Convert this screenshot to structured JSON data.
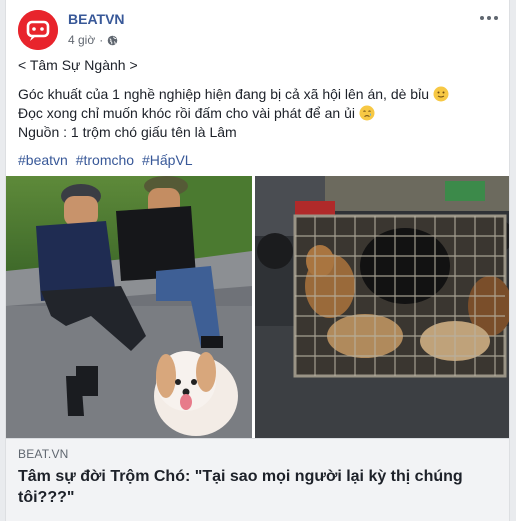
{
  "post": {
    "page_name": "BEATVN",
    "time": "4 giờ",
    "privacy_icon": "globe-icon",
    "lines": [
      "< Tâm Sự Ngành >",
      "Góc khuất của 1 nghề nghiệp hiện đang bị cả xã hội lên án, dè bỉu",
      "Đọc xong chỉ muốn khóc rồi đấm cho vài phát để an ủi",
      "Nguồn : 1 trộm chó giấu tên là Lâm"
    ],
    "hashtags": [
      "#beatvn",
      "#tromcho",
      "#HấpVL"
    ]
  },
  "link": {
    "domain": "BEAT.VN",
    "title": "Tâm sự đời Trộm Chó: \"Tại sao mọi người lại kỳ thị chúng tôi???\""
  },
  "colors": {
    "brand": "#e8242c",
    "link": "#385898"
  }
}
